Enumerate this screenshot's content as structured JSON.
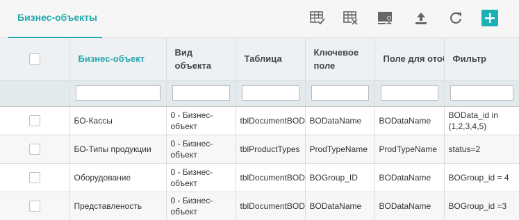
{
  "tab": {
    "label": "Бизнес-объекты"
  },
  "toolbar": {
    "icons": [
      "grid-check-icon",
      "grid-delete-icon",
      "screen-user-icon",
      "upload-icon",
      "refresh-icon",
      "add-icon"
    ],
    "add_symbol": "+"
  },
  "colors": {
    "accent": "#23a8ae",
    "add_button": "#1ab0b4"
  },
  "columns": [
    {
      "key": "name",
      "label": "Бизнес-объект",
      "sorted": true
    },
    {
      "key": "type",
      "label": "Вид объекта"
    },
    {
      "key": "table",
      "label": "Таблица"
    },
    {
      "key": "key_field",
      "label": "Ключевое поле"
    },
    {
      "key": "display_field",
      "label": "Поле для отображения"
    },
    {
      "key": "filter",
      "label": "Фильтр"
    }
  ],
  "filters": {
    "name": "",
    "type": "",
    "table": "",
    "key_field": "",
    "display_field": "",
    "filter": ""
  },
  "rows": [
    {
      "name": "БО-Кассы",
      "type": "0 - Бизнес-объект",
      "table": "tblDocumentBOD",
      "key_field": "BODataName",
      "display_field": "BODataName",
      "filter": "BOData_id in (1,2,3,4,5)"
    },
    {
      "name": "БО-Типы продукции",
      "type": "0 - Бизнес-объект",
      "table": "tblProductTypes",
      "key_field": "ProdTypeName",
      "display_field": "ProdTypeName",
      "filter": "status=2"
    },
    {
      "name": "Оборудование",
      "type": "0 - Бизнес-объект",
      "table": "tblDocumentBOD",
      "key_field": "BOGroup_ID",
      "display_field": "BODataName",
      "filter": "BOGroup_id = 4"
    },
    {
      "name": "Представленость",
      "type": "0 - Бизнес-объект",
      "table": "tblDocumentBOD",
      "key_field": "BODataName",
      "display_field": "BODataName",
      "filter": "BOGroup_id =3"
    }
  ]
}
